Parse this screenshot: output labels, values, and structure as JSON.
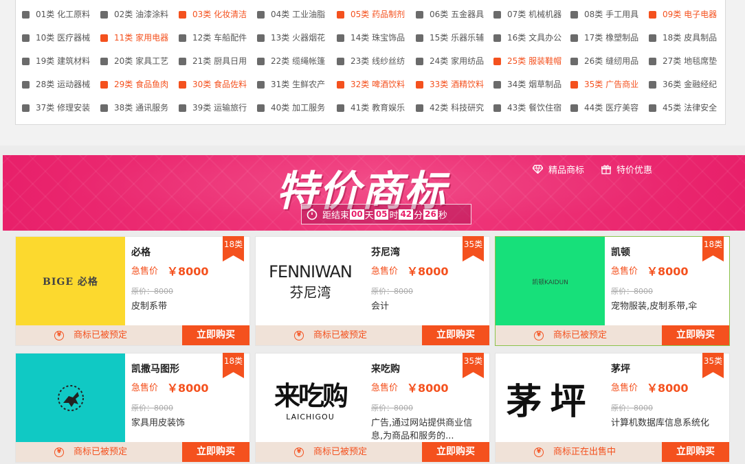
{
  "categories": [
    {
      "label": "01类 化工原料",
      "icon": "flask-icon",
      "hot": false
    },
    {
      "label": "02类 油漆涂料",
      "icon": "paint-roller-icon",
      "hot": false
    },
    {
      "label": "03类 化妆清洁",
      "icon": "cosmetics-icon",
      "hot": true
    },
    {
      "label": "04类 工业油脂",
      "icon": "oil-drop-icon",
      "hot": false
    },
    {
      "label": "05类 药品制剂",
      "icon": "medicine-icon",
      "hot": true
    },
    {
      "label": "06类 五金器具",
      "icon": "wrench-icon",
      "hot": false
    },
    {
      "label": "07类 机械机器",
      "icon": "machine-icon",
      "hot": false
    },
    {
      "label": "08类 手工用具",
      "icon": "hand-tool-icon",
      "hot": false
    },
    {
      "label": "09类 电子电器",
      "icon": "battery-icon",
      "hot": true
    },
    {
      "label": "10类 医疗器械",
      "icon": "medical-device-icon",
      "hot": false
    },
    {
      "label": "11类 家用电器",
      "icon": "appliance-icon",
      "hot": true
    },
    {
      "label": "12类 车船配件",
      "icon": "car-icon",
      "hot": false
    },
    {
      "label": "13类 火器烟花",
      "icon": "firework-icon",
      "hot": false
    },
    {
      "label": "14类 珠宝饰品",
      "icon": "gem-icon",
      "hot": false
    },
    {
      "label": "15类 乐器乐辅",
      "icon": "music-icon",
      "hot": false
    },
    {
      "label": "16类 文具办公",
      "icon": "stationery-icon",
      "hot": false
    },
    {
      "label": "17类 橡塑制品",
      "icon": "rubber-icon",
      "hot": false
    },
    {
      "label": "18类 皮具制品",
      "icon": "bag-icon",
      "hot": false
    },
    {
      "label": "19类 建筑材料",
      "icon": "brick-icon",
      "hot": false
    },
    {
      "label": "20类 家具工艺",
      "icon": "furniture-icon",
      "hot": false
    },
    {
      "label": "21类 厨具日用",
      "icon": "kitchen-icon",
      "hot": false
    },
    {
      "label": "22类 缆绳帐篷",
      "icon": "tent-icon",
      "hot": false
    },
    {
      "label": "23类 线纱丝纺",
      "icon": "shirt-icon",
      "hot": false
    },
    {
      "label": "24类 家用纺品",
      "icon": "textile-icon",
      "hot": false
    },
    {
      "label": "25类 服装鞋帽",
      "icon": "clothing-icon",
      "hot": true
    },
    {
      "label": "26类 缝纫用品",
      "icon": "sewing-icon",
      "hot": false
    },
    {
      "label": "27类 地毯席垫",
      "icon": "carpet-icon",
      "hot": false
    },
    {
      "label": "28类 运动器械",
      "icon": "ball-icon",
      "hot": false
    },
    {
      "label": "29类 食品鱼肉",
      "icon": "food-icon",
      "hot": true
    },
    {
      "label": "30类 食品佐料",
      "icon": "seasoning-icon",
      "hot": true
    },
    {
      "label": "31类 生鲜农产",
      "icon": "wheat-icon",
      "hot": false
    },
    {
      "label": "32类 啤酒饮料",
      "icon": "beer-icon",
      "hot": true
    },
    {
      "label": "33类 酒精饮料",
      "icon": "wine-icon",
      "hot": true
    },
    {
      "label": "34类 烟草制品",
      "icon": "tobacco-icon",
      "hot": false
    },
    {
      "label": "35类 广告商业",
      "icon": "ad-icon",
      "hot": true
    },
    {
      "label": "36类 金融经纪",
      "icon": "finance-icon",
      "hot": false
    },
    {
      "label": "37类 修理安装",
      "icon": "repair-icon",
      "hot": false
    },
    {
      "label": "38类 通讯服务",
      "icon": "phone-icon",
      "hot": false
    },
    {
      "label": "39类 运输旅行",
      "icon": "truck-icon",
      "hot": false
    },
    {
      "label": "40类 加工服务",
      "icon": "factory-icon",
      "hot": false
    },
    {
      "label": "41类 教育娱乐",
      "icon": "graduation-cap-icon",
      "hot": false
    },
    {
      "label": "42类 科技研究",
      "icon": "research-icon",
      "hot": false
    },
    {
      "label": "43类 餐饮住宿",
      "icon": "fork-knife-icon",
      "hot": false
    },
    {
      "label": "44类 医疗美容",
      "icon": "face-icon",
      "hot": false
    },
    {
      "label": "45类 法律安全",
      "icon": "gavel-icon",
      "hot": false
    }
  ],
  "banner": {
    "title": "特价商标",
    "countdown_label": "距结束",
    "days": "00",
    "days_unit": "天",
    "hours": "05",
    "hours_unit": "时",
    "minutes": "42",
    "minutes_unit": "分",
    "seconds": "26",
    "seconds_unit": "秒",
    "link_premium": "精品商标",
    "link_special": "特价优惠"
  },
  "products": [
    {
      "name": "必格",
      "price_label": "急售价",
      "price": "￥8000",
      "original": "原价：8000",
      "desc": "皮制系带",
      "class_tag": "18类",
      "status": "商标已被预定",
      "buy": "立即购买",
      "logo_text": "BIGE 必格",
      "img_bg": "#fcd92e"
    },
    {
      "name": "芬尼湾",
      "price_label": "急售价",
      "price": "￥8000",
      "original": "原价：8000",
      "desc": "会计",
      "class_tag": "35类",
      "status": "商标已被预定",
      "buy": "立即购买",
      "logo_text": "FENNIWAN",
      "logo_sub": "芬尼湾",
      "img_bg": "#ffffff"
    },
    {
      "name": "凯顿",
      "price_label": "急售价",
      "price": "￥8000",
      "original": "原价：8000",
      "desc": "宠物服装,皮制系带,伞",
      "class_tag": "18类",
      "status": "商标已被预定",
      "buy": "立即购买",
      "logo_text": "凯顿KAIDUN",
      "img_bg": "#17e07a"
    },
    {
      "name": "凯撒马图形",
      "price_label": "急售价",
      "price": "￥8000",
      "original": "原价：8000",
      "desc": "家具用皮装饰",
      "class_tag": "18类",
      "status": "商标已被预定",
      "buy": "立即购买",
      "img_bg": "#10c9c4"
    },
    {
      "name": "来吃购",
      "price_label": "急售价",
      "price": "￥8000",
      "original": "原价：8000",
      "desc": "广告,通过网站提供商业信息,为商品和服务的...",
      "class_tag": "35类",
      "status": "商标已被预定",
      "buy": "立即购买",
      "logo_text": "来吃购",
      "logo_sub": "LAICHIGOU",
      "img_bg": "#ffffff"
    },
    {
      "name": "茅坪",
      "price_label": "急售价",
      "price": "￥8000",
      "original": "原价：8000",
      "desc": "计算机数据库信息系统化",
      "class_tag": "35类",
      "status": "商标正在出售中",
      "buy": "立即购买",
      "logo_text": "茅坪",
      "img_bg": "#ffffff"
    }
  ]
}
